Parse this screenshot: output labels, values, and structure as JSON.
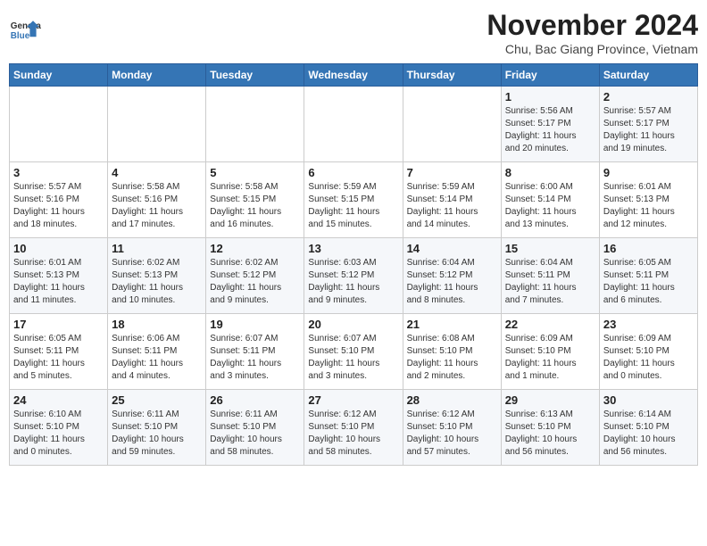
{
  "header": {
    "logo_line1": "General",
    "logo_line2": "Blue",
    "month_title": "November 2024",
    "subtitle": "Chu, Bac Giang Province, Vietnam"
  },
  "weekdays": [
    "Sunday",
    "Monday",
    "Tuesday",
    "Wednesday",
    "Thursday",
    "Friday",
    "Saturday"
  ],
  "weeks": [
    [
      {
        "day": "",
        "info": ""
      },
      {
        "day": "",
        "info": ""
      },
      {
        "day": "",
        "info": ""
      },
      {
        "day": "",
        "info": ""
      },
      {
        "day": "",
        "info": ""
      },
      {
        "day": "1",
        "info": "Sunrise: 5:56 AM\nSunset: 5:17 PM\nDaylight: 11 hours\nand 20 minutes."
      },
      {
        "day": "2",
        "info": "Sunrise: 5:57 AM\nSunset: 5:17 PM\nDaylight: 11 hours\nand 19 minutes."
      }
    ],
    [
      {
        "day": "3",
        "info": "Sunrise: 5:57 AM\nSunset: 5:16 PM\nDaylight: 11 hours\nand 18 minutes."
      },
      {
        "day": "4",
        "info": "Sunrise: 5:58 AM\nSunset: 5:16 PM\nDaylight: 11 hours\nand 17 minutes."
      },
      {
        "day": "5",
        "info": "Sunrise: 5:58 AM\nSunset: 5:15 PM\nDaylight: 11 hours\nand 16 minutes."
      },
      {
        "day": "6",
        "info": "Sunrise: 5:59 AM\nSunset: 5:15 PM\nDaylight: 11 hours\nand 15 minutes."
      },
      {
        "day": "7",
        "info": "Sunrise: 5:59 AM\nSunset: 5:14 PM\nDaylight: 11 hours\nand 14 minutes."
      },
      {
        "day": "8",
        "info": "Sunrise: 6:00 AM\nSunset: 5:14 PM\nDaylight: 11 hours\nand 13 minutes."
      },
      {
        "day": "9",
        "info": "Sunrise: 6:01 AM\nSunset: 5:13 PM\nDaylight: 11 hours\nand 12 minutes."
      }
    ],
    [
      {
        "day": "10",
        "info": "Sunrise: 6:01 AM\nSunset: 5:13 PM\nDaylight: 11 hours\nand 11 minutes."
      },
      {
        "day": "11",
        "info": "Sunrise: 6:02 AM\nSunset: 5:13 PM\nDaylight: 11 hours\nand 10 minutes."
      },
      {
        "day": "12",
        "info": "Sunrise: 6:02 AM\nSunset: 5:12 PM\nDaylight: 11 hours\nand 9 minutes."
      },
      {
        "day": "13",
        "info": "Sunrise: 6:03 AM\nSunset: 5:12 PM\nDaylight: 11 hours\nand 9 minutes."
      },
      {
        "day": "14",
        "info": "Sunrise: 6:04 AM\nSunset: 5:12 PM\nDaylight: 11 hours\nand 8 minutes."
      },
      {
        "day": "15",
        "info": "Sunrise: 6:04 AM\nSunset: 5:11 PM\nDaylight: 11 hours\nand 7 minutes."
      },
      {
        "day": "16",
        "info": "Sunrise: 6:05 AM\nSunset: 5:11 PM\nDaylight: 11 hours\nand 6 minutes."
      }
    ],
    [
      {
        "day": "17",
        "info": "Sunrise: 6:05 AM\nSunset: 5:11 PM\nDaylight: 11 hours\nand 5 minutes."
      },
      {
        "day": "18",
        "info": "Sunrise: 6:06 AM\nSunset: 5:11 PM\nDaylight: 11 hours\nand 4 minutes."
      },
      {
        "day": "19",
        "info": "Sunrise: 6:07 AM\nSunset: 5:11 PM\nDaylight: 11 hours\nand 3 minutes."
      },
      {
        "day": "20",
        "info": "Sunrise: 6:07 AM\nSunset: 5:10 PM\nDaylight: 11 hours\nand 3 minutes."
      },
      {
        "day": "21",
        "info": "Sunrise: 6:08 AM\nSunset: 5:10 PM\nDaylight: 11 hours\nand 2 minutes."
      },
      {
        "day": "22",
        "info": "Sunrise: 6:09 AM\nSunset: 5:10 PM\nDaylight: 11 hours\nand 1 minute."
      },
      {
        "day": "23",
        "info": "Sunrise: 6:09 AM\nSunset: 5:10 PM\nDaylight: 11 hours\nand 0 minutes."
      }
    ],
    [
      {
        "day": "24",
        "info": "Sunrise: 6:10 AM\nSunset: 5:10 PM\nDaylight: 11 hours\nand 0 minutes."
      },
      {
        "day": "25",
        "info": "Sunrise: 6:11 AM\nSunset: 5:10 PM\nDaylight: 10 hours\nand 59 minutes."
      },
      {
        "day": "26",
        "info": "Sunrise: 6:11 AM\nSunset: 5:10 PM\nDaylight: 10 hours\nand 58 minutes."
      },
      {
        "day": "27",
        "info": "Sunrise: 6:12 AM\nSunset: 5:10 PM\nDaylight: 10 hours\nand 58 minutes."
      },
      {
        "day": "28",
        "info": "Sunrise: 6:12 AM\nSunset: 5:10 PM\nDaylight: 10 hours\nand 57 minutes."
      },
      {
        "day": "29",
        "info": "Sunrise: 6:13 AM\nSunset: 5:10 PM\nDaylight: 10 hours\nand 56 minutes."
      },
      {
        "day": "30",
        "info": "Sunrise: 6:14 AM\nSunset: 5:10 PM\nDaylight: 10 hours\nand 56 minutes."
      }
    ]
  ]
}
